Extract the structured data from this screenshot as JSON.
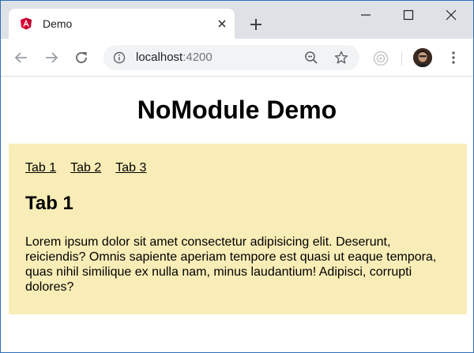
{
  "browser": {
    "tab": {
      "title": "Demo",
      "favicon": "angular-icon"
    },
    "address": {
      "host": "localhost",
      "port": ":4200"
    },
    "colors": {
      "tabstrip": "#dee1e6",
      "omnibox": "#f1f3f4"
    }
  },
  "page": {
    "title": "NoModule Demo",
    "tabs": [
      {
        "label": "Tab 1"
      },
      {
        "label": "Tab 2"
      },
      {
        "label": "Tab 3"
      }
    ],
    "active_heading": "Tab 1",
    "content": "Lorem ipsum dolor sit amet consectetur adipisicing elit. Deserunt, reiciendis? Omnis sapiente aperiam tempore est quasi ut eaque tempora, quas nihil similique ex nulla nam, minus laudantium! Adipisci, corrupti dolores?",
    "colors": {
      "panel": "#f9edb7"
    }
  }
}
